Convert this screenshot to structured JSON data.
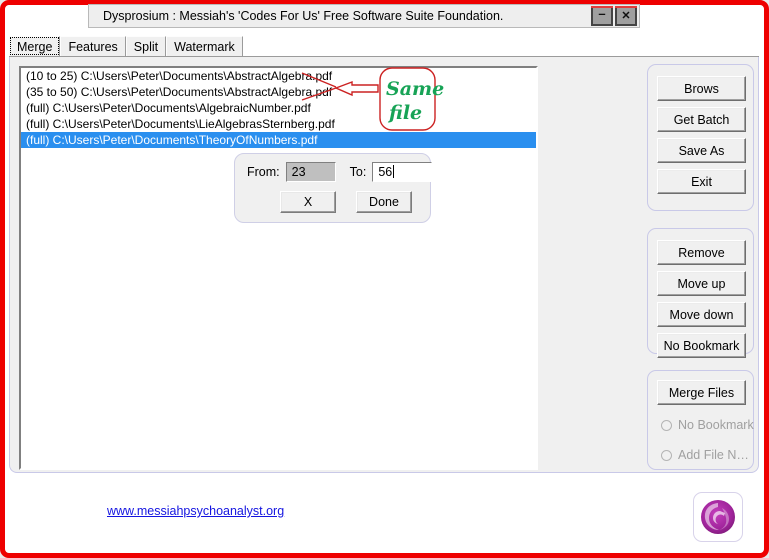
{
  "window": {
    "title": "Dysprosium : Messiah's 'Codes For Us' Free Software Suite Foundation.",
    "minimize_label": "–",
    "close_label": "✕",
    "frame_color": "#ee0000"
  },
  "tabs": [
    {
      "label": "Merge",
      "active": true
    },
    {
      "label": "Features",
      "active": false
    },
    {
      "label": "Split",
      "active": false
    },
    {
      "label": "Watermark",
      "active": false
    }
  ],
  "file_list": {
    "rows": [
      {
        "text": "(10 to 25) C:\\Users\\Peter\\Documents\\AbstractAlgebra.pdf",
        "selected": false
      },
      {
        "text": "(35 to 50) C:\\Users\\Peter\\Documents\\AbstractAlgebra.pdf",
        "selected": false
      },
      {
        "text": "(full) C:\\Users\\Peter\\Documents\\AlgebraicNumber.pdf",
        "selected": false
      },
      {
        "text": "(full) C:\\Users\\Peter\\Documents\\LieAlgebrasSternberg.pdf",
        "selected": false
      },
      {
        "text": "(full) C:\\Users\\Peter\\Documents\\TheoryOfNumbers.pdf",
        "selected": true
      }
    ],
    "selection_color": "#2a8fef"
  },
  "annotation": {
    "line1": "Same",
    "line2": "file",
    "text_color": "#17a356",
    "outline_color": "#cc2222"
  },
  "range_dialog": {
    "from_label": "From:",
    "from_value": "23",
    "to_label": "To:",
    "to_value": "56",
    "cancel_label": "X",
    "done_label": "Done"
  },
  "buttons_main": [
    {
      "label": "Brows"
    },
    {
      "label": "Get Batch"
    },
    {
      "label": "Save As"
    },
    {
      "label": "Exit"
    }
  ],
  "buttons_edit": [
    {
      "label": "Remove"
    },
    {
      "label": "Move up"
    },
    {
      "label": "Move down"
    },
    {
      "label": "No Bookmark"
    }
  ],
  "buttons_merge": {
    "merge_label": "Merge Files",
    "radios": [
      {
        "label": "No Bookmark",
        "selected": false,
        "disabled": true
      },
      {
        "label": "Add File N…",
        "selected": false,
        "disabled": true
      }
    ]
  },
  "footer": {
    "link": "www.messiahpsychoanalyst.org",
    "link_color": "#1414e0",
    "logo_name": "phoenix-logo",
    "logo_color": "#a0249b"
  }
}
